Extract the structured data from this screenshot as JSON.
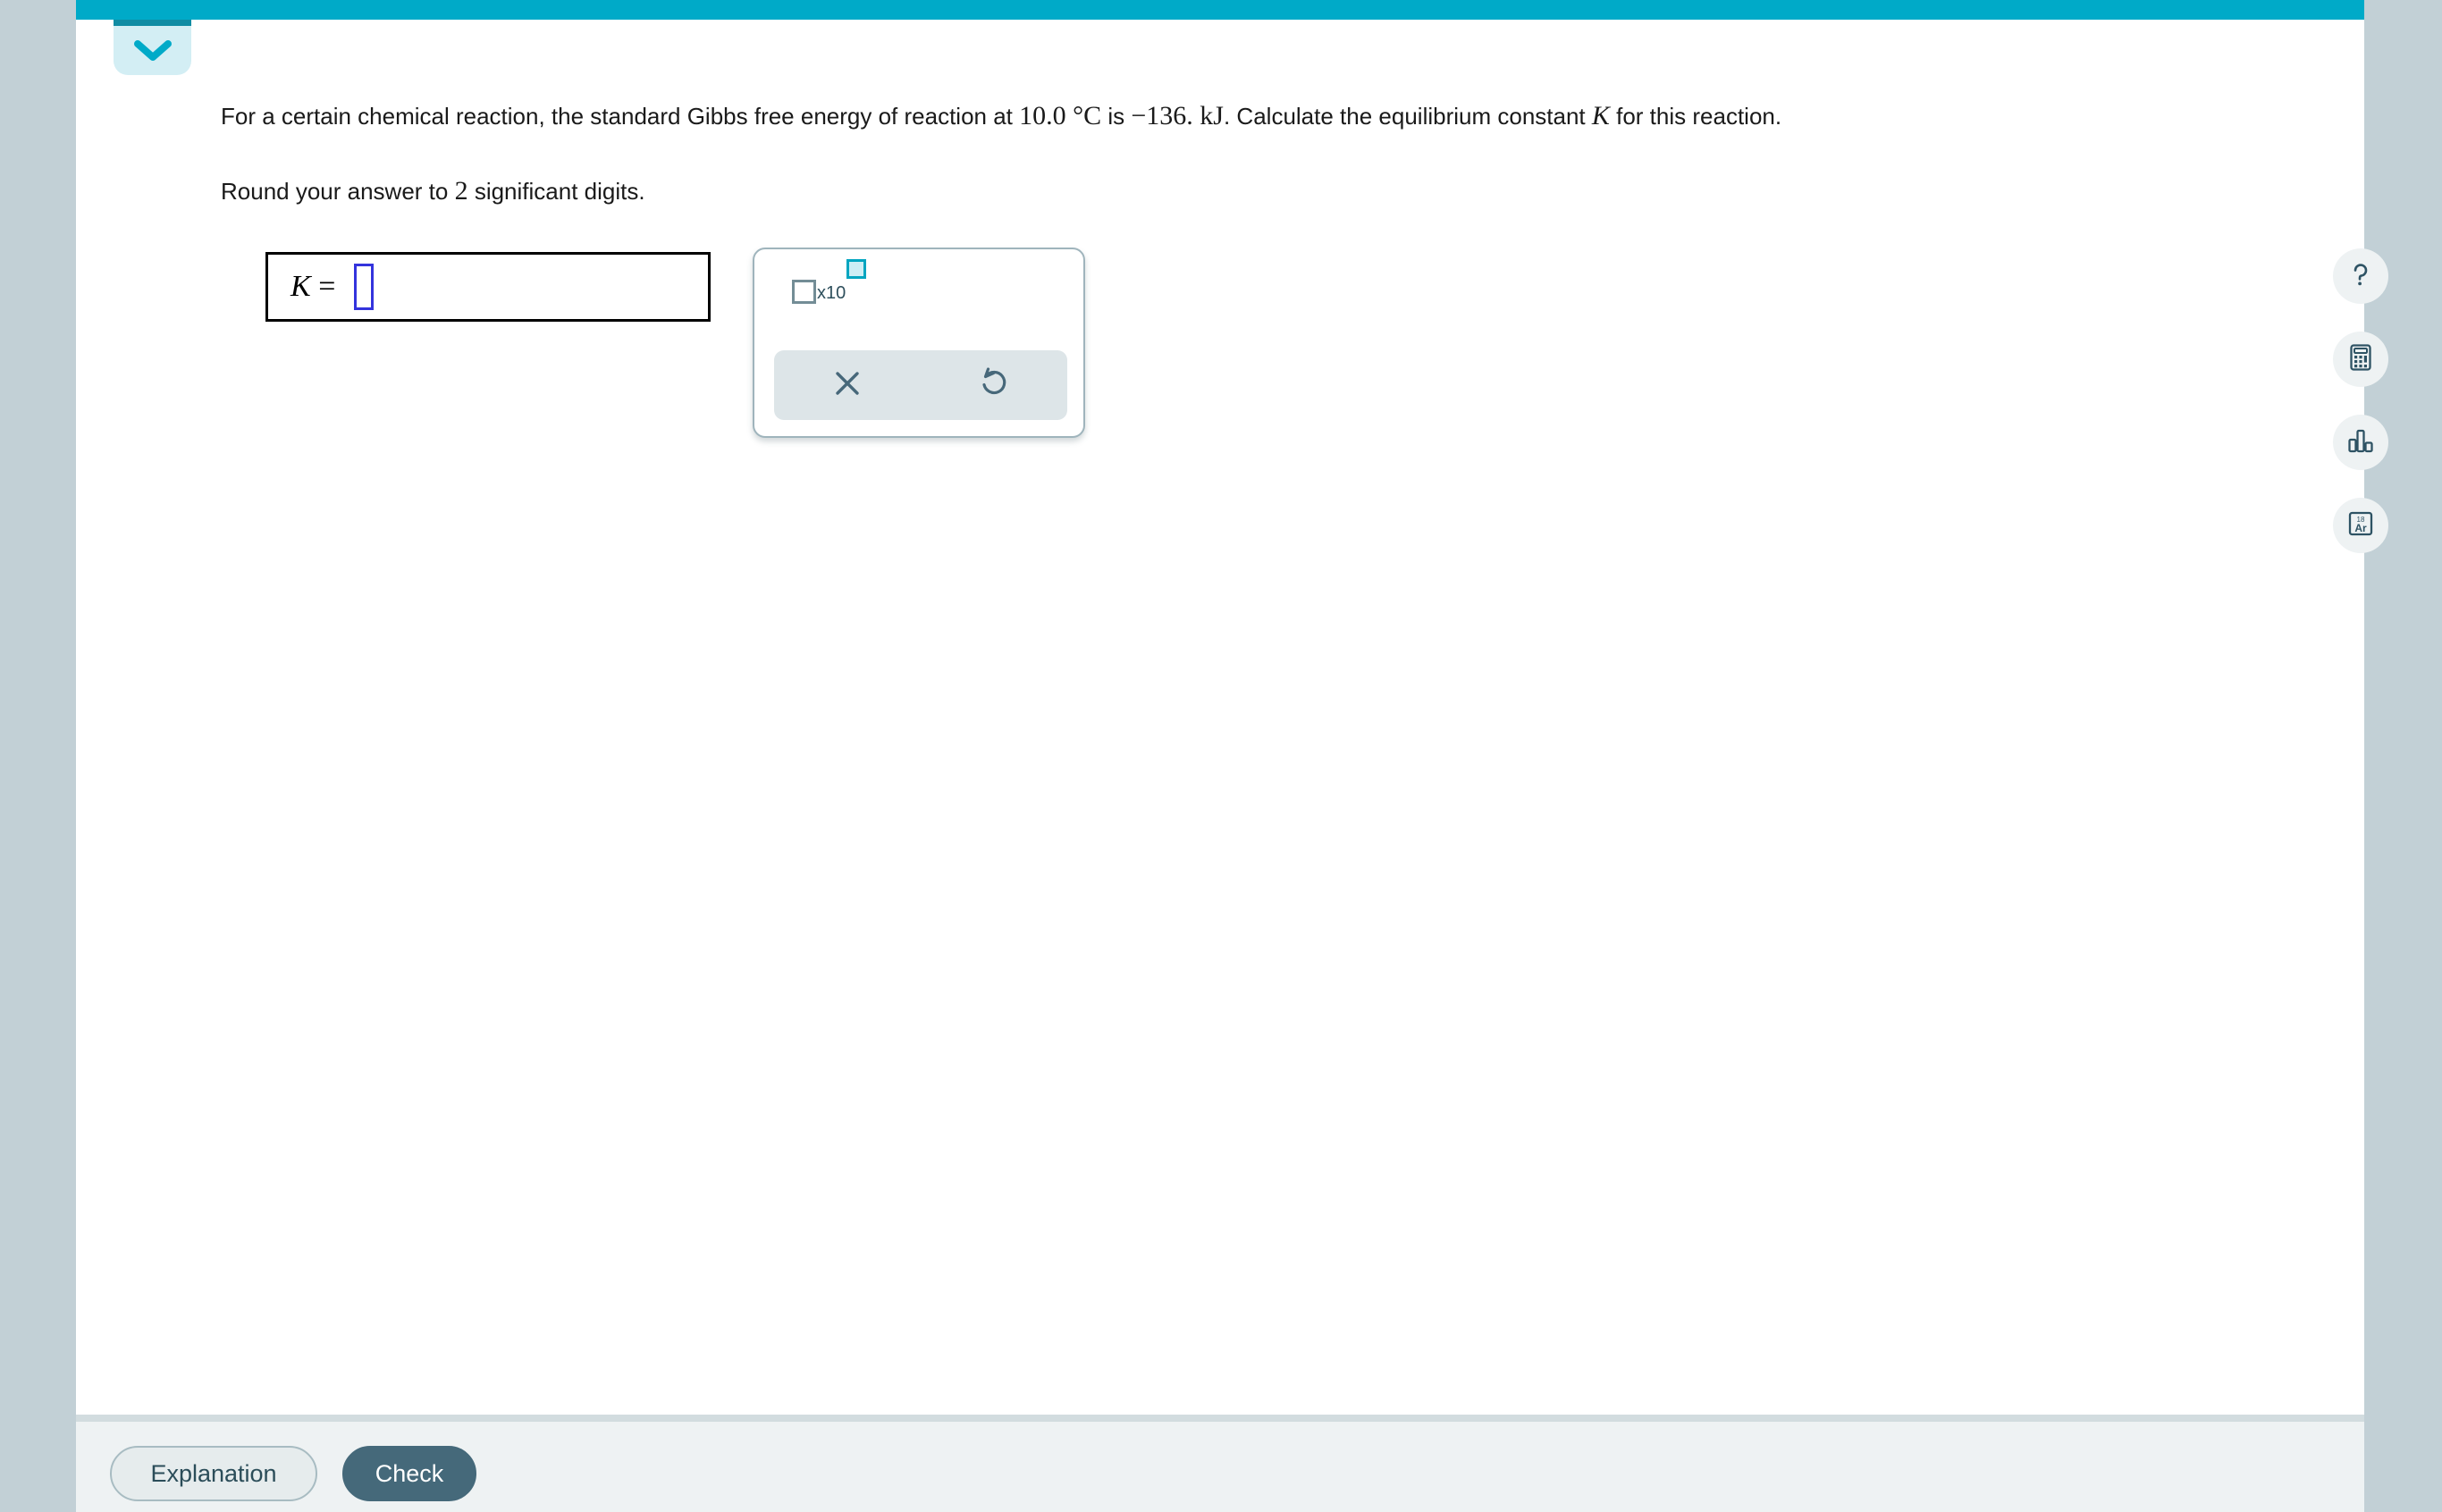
{
  "colors": {
    "teal_bar": "#00aac8",
    "tab_fill": "#d3eef4",
    "tab_accent": "#0f8ca3",
    "page_backdrop": "#c2d0d6",
    "footer_bg": "#eef2f3",
    "check_button": "#45697a",
    "input_caret_border": "#3333dd",
    "exponent_highlight": "#cdeef5",
    "exponent_border": "#00a5c0"
  },
  "top_tab": {
    "icon": "chevron-down-icon"
  },
  "question": {
    "line1_part1": "For a certain chemical reaction, the standard Gibbs free energy of reaction at ",
    "line1_temp": "10.0 °C",
    "line1_part2": " is ",
    "line1_energy": "−136. kJ",
    "line1_part3": ". Calculate the equilibrium constant ",
    "line1_symbol": "K",
    "line1_part4": " for this reaction.",
    "line2_part1": "Round your answer to ",
    "line2_digits": "2",
    "line2_part2": " significant digits."
  },
  "answer": {
    "label_variable": "K",
    "label_equals": " = ",
    "value": "",
    "placeholder": ""
  },
  "palette": {
    "sci_notation": {
      "name": "scientific-notation-template",
      "mantissa": "",
      "times_ten": "x10",
      "exponent": ""
    },
    "actions": [
      {
        "name": "clear-button",
        "icon": "close-x-icon"
      },
      {
        "name": "undo-button",
        "icon": "undo-arrow-icon"
      }
    ]
  },
  "rail": [
    {
      "name": "help-button",
      "icon": "question-mark-icon",
      "label": "?"
    },
    {
      "name": "calculator-button",
      "icon": "calculator-icon"
    },
    {
      "name": "data-button",
      "icon": "bar-chart-icon"
    },
    {
      "name": "periodic-table-button",
      "icon": "periodic-table-icon",
      "element_symbol": "Ar",
      "element_number": "18"
    }
  ],
  "footer": {
    "explanation_label": "Explanation",
    "check_label": "Check"
  }
}
